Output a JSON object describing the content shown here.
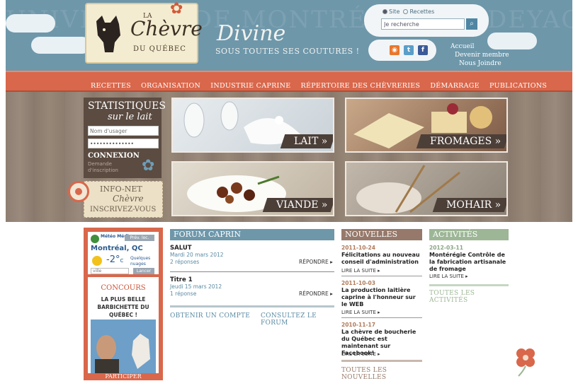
{
  "header": {
    "logo": {
      "la": "LA",
      "name": "Chèvre",
      "sub": "DU QUÉBEC"
    },
    "tagline": {
      "title": "Divine",
      "subtitle": "SOUS TOUTES SES COUTURES !"
    },
    "search": {
      "option_site": "Site",
      "option_recipes": "Recettes",
      "value": "Je recherche"
    },
    "top_links": [
      "Accueil",
      "Devenir membre",
      "Nous Joindre"
    ],
    "watermark": "UNIVERSITÉ DE MONTRÉAL · PANDEYAOURT"
  },
  "nav": {
    "items": [
      "RECETTES",
      "ORGANISATION",
      "INDUSTRIE CAPRINE",
      "RÉPERTOIRE DES CHÈVRERIES",
      "DÉMARRAGE",
      "PUBLICATIONS"
    ]
  },
  "stats": {
    "title": "STATISTIQUES",
    "subtitle": "sur le lait",
    "username_placeholder": "Nom d'usager",
    "password_value": "••••••••••••••",
    "login": "CONNEXION",
    "request": "Demande d'inscription"
  },
  "infonet": {
    "line1": "INFO-NET",
    "line2": "Chèvre",
    "line3": "INSCRIVEZ-VOUS"
  },
  "tiles": {
    "lait": "LAIT »",
    "fromages": "FROMAGES »",
    "viande": "VIANDE »",
    "mohair": "MOHAIR »"
  },
  "meteo": {
    "brand": "Météo Média",
    "prev": "Prév. loc.",
    "city": "Montréal, QC",
    "temp": "-2°",
    "unit": "C",
    "condition": "Quelques nuages",
    "ville_placeholder": "ville",
    "go": "Lancer",
    "contest_title": "CONCOURS",
    "contest_desc": "LA PLUS BELLE BARBICHETTE DU QUÉBEC !",
    "participate": "PARTICIPER"
  },
  "forum": {
    "title": "FORUM CAPRIN",
    "posts": [
      {
        "title": "SALUT",
        "date": "Mardi 20 mars 2012",
        "replies": "2 réponses",
        "reply": "RÉPONDRE ▸"
      },
      {
        "title": "Titre 1",
        "date": "Jeudi 15 mars 2012",
        "replies": "1 réponse",
        "reply": "RÉPONDRE ▸"
      }
    ],
    "account_link": "OBTENIR UN COMPTE",
    "forum_link": "CONSULTEZ LE FORUM"
  },
  "news": {
    "title": "NOUVELLES",
    "items": [
      {
        "date": "2011-10-24",
        "title": "Félicitations au nouveau conseil d'administration",
        "more": "LIRE LA SUITE ▸"
      },
      {
        "date": "2011-10-03",
        "title": "La production laitière caprine à l'honneur sur le WEB",
        "more": "LIRE LA SUITE ▸"
      },
      {
        "date": "2010-11-17",
        "title": "La chèvre de boucherie du Québec est maintenant sur Facebook!",
        "more": "LIRE LA SUITE ▸"
      }
    ],
    "all": "TOUTES LES NOUVELLES"
  },
  "activities": {
    "title": "ACTIVITÉS",
    "items": [
      {
        "date": "2012-03-11",
        "title": "Montérégie Contrôle de la fabrication artisanale de fromage",
        "more": "LIRE LA SUITE ▸"
      }
    ],
    "all": "TOUTES LES ACTIVITÉS"
  },
  "colors": {
    "sky": "#6e97aa",
    "nav": "#d9674b",
    "wood": "#8f7f72",
    "dark": "#4c3f38",
    "news": "#96796a",
    "acts": "#9db796"
  }
}
